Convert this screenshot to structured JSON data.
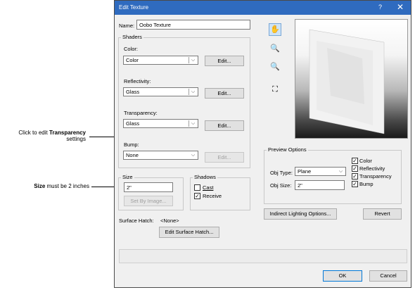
{
  "annotations": {
    "transparency_line1_prefix": "Click to edit ",
    "transparency_line1_bold": "Transparency",
    "transparency_line2": "settings",
    "size_bold": "Size",
    "size_rest": " must be 2 inches"
  },
  "window": {
    "title": "Edit Texture",
    "help": "?",
    "close": "✕"
  },
  "name": {
    "label": "Name:",
    "value": "Oobo Texture"
  },
  "shaders": {
    "title": "Shaders",
    "color": {
      "label": "Color:",
      "value": "Color",
      "edit": "Edit..."
    },
    "reflectivity": {
      "label": "Reflectivity:",
      "value": "Glass",
      "edit": "Edit..."
    },
    "transparency": {
      "label": "Transparency:",
      "value": "Glass",
      "edit": "Edit..."
    },
    "bump": {
      "label": "Bump:",
      "value": "None",
      "edit": "Edit..."
    }
  },
  "size": {
    "title": "Size",
    "value": "2\"",
    "set_by_image": "Set By Image..."
  },
  "shadows": {
    "title": "Shadows",
    "cast": {
      "label": "Cast",
      "checked": false
    },
    "receive": {
      "label": "Receive",
      "checked": true
    }
  },
  "surface_hatch": {
    "label": "Surface Hatch:",
    "value": "<None>",
    "edit": "Edit Surface Hatch..."
  },
  "tools": {
    "pan": "hand-icon",
    "zoom_in": "zoom-in-icon",
    "zoom_out": "zoom-out-icon",
    "fit": "zoom-fit-icon"
  },
  "preview_options": {
    "title": "Preview Options",
    "obj_type_label": "Obj Type:",
    "obj_type_value": "Plane",
    "obj_size_label": "Obj Size:",
    "obj_size_value": "2\"",
    "color": {
      "label": "Color",
      "checked": true
    },
    "reflectivity": {
      "label": "Reflectivity",
      "checked": true
    },
    "transparency": {
      "label": "Transparency",
      "checked": true
    },
    "bump": {
      "label": "Bump",
      "checked": true
    }
  },
  "buttons": {
    "indirect_lighting": "Indirect Lighting Options...",
    "revert": "Revert",
    "ok": "OK",
    "cancel": "Cancel"
  },
  "colors": {
    "titlebar": "#2f6bbf",
    "dialog_bg": "#f0f0f0"
  }
}
